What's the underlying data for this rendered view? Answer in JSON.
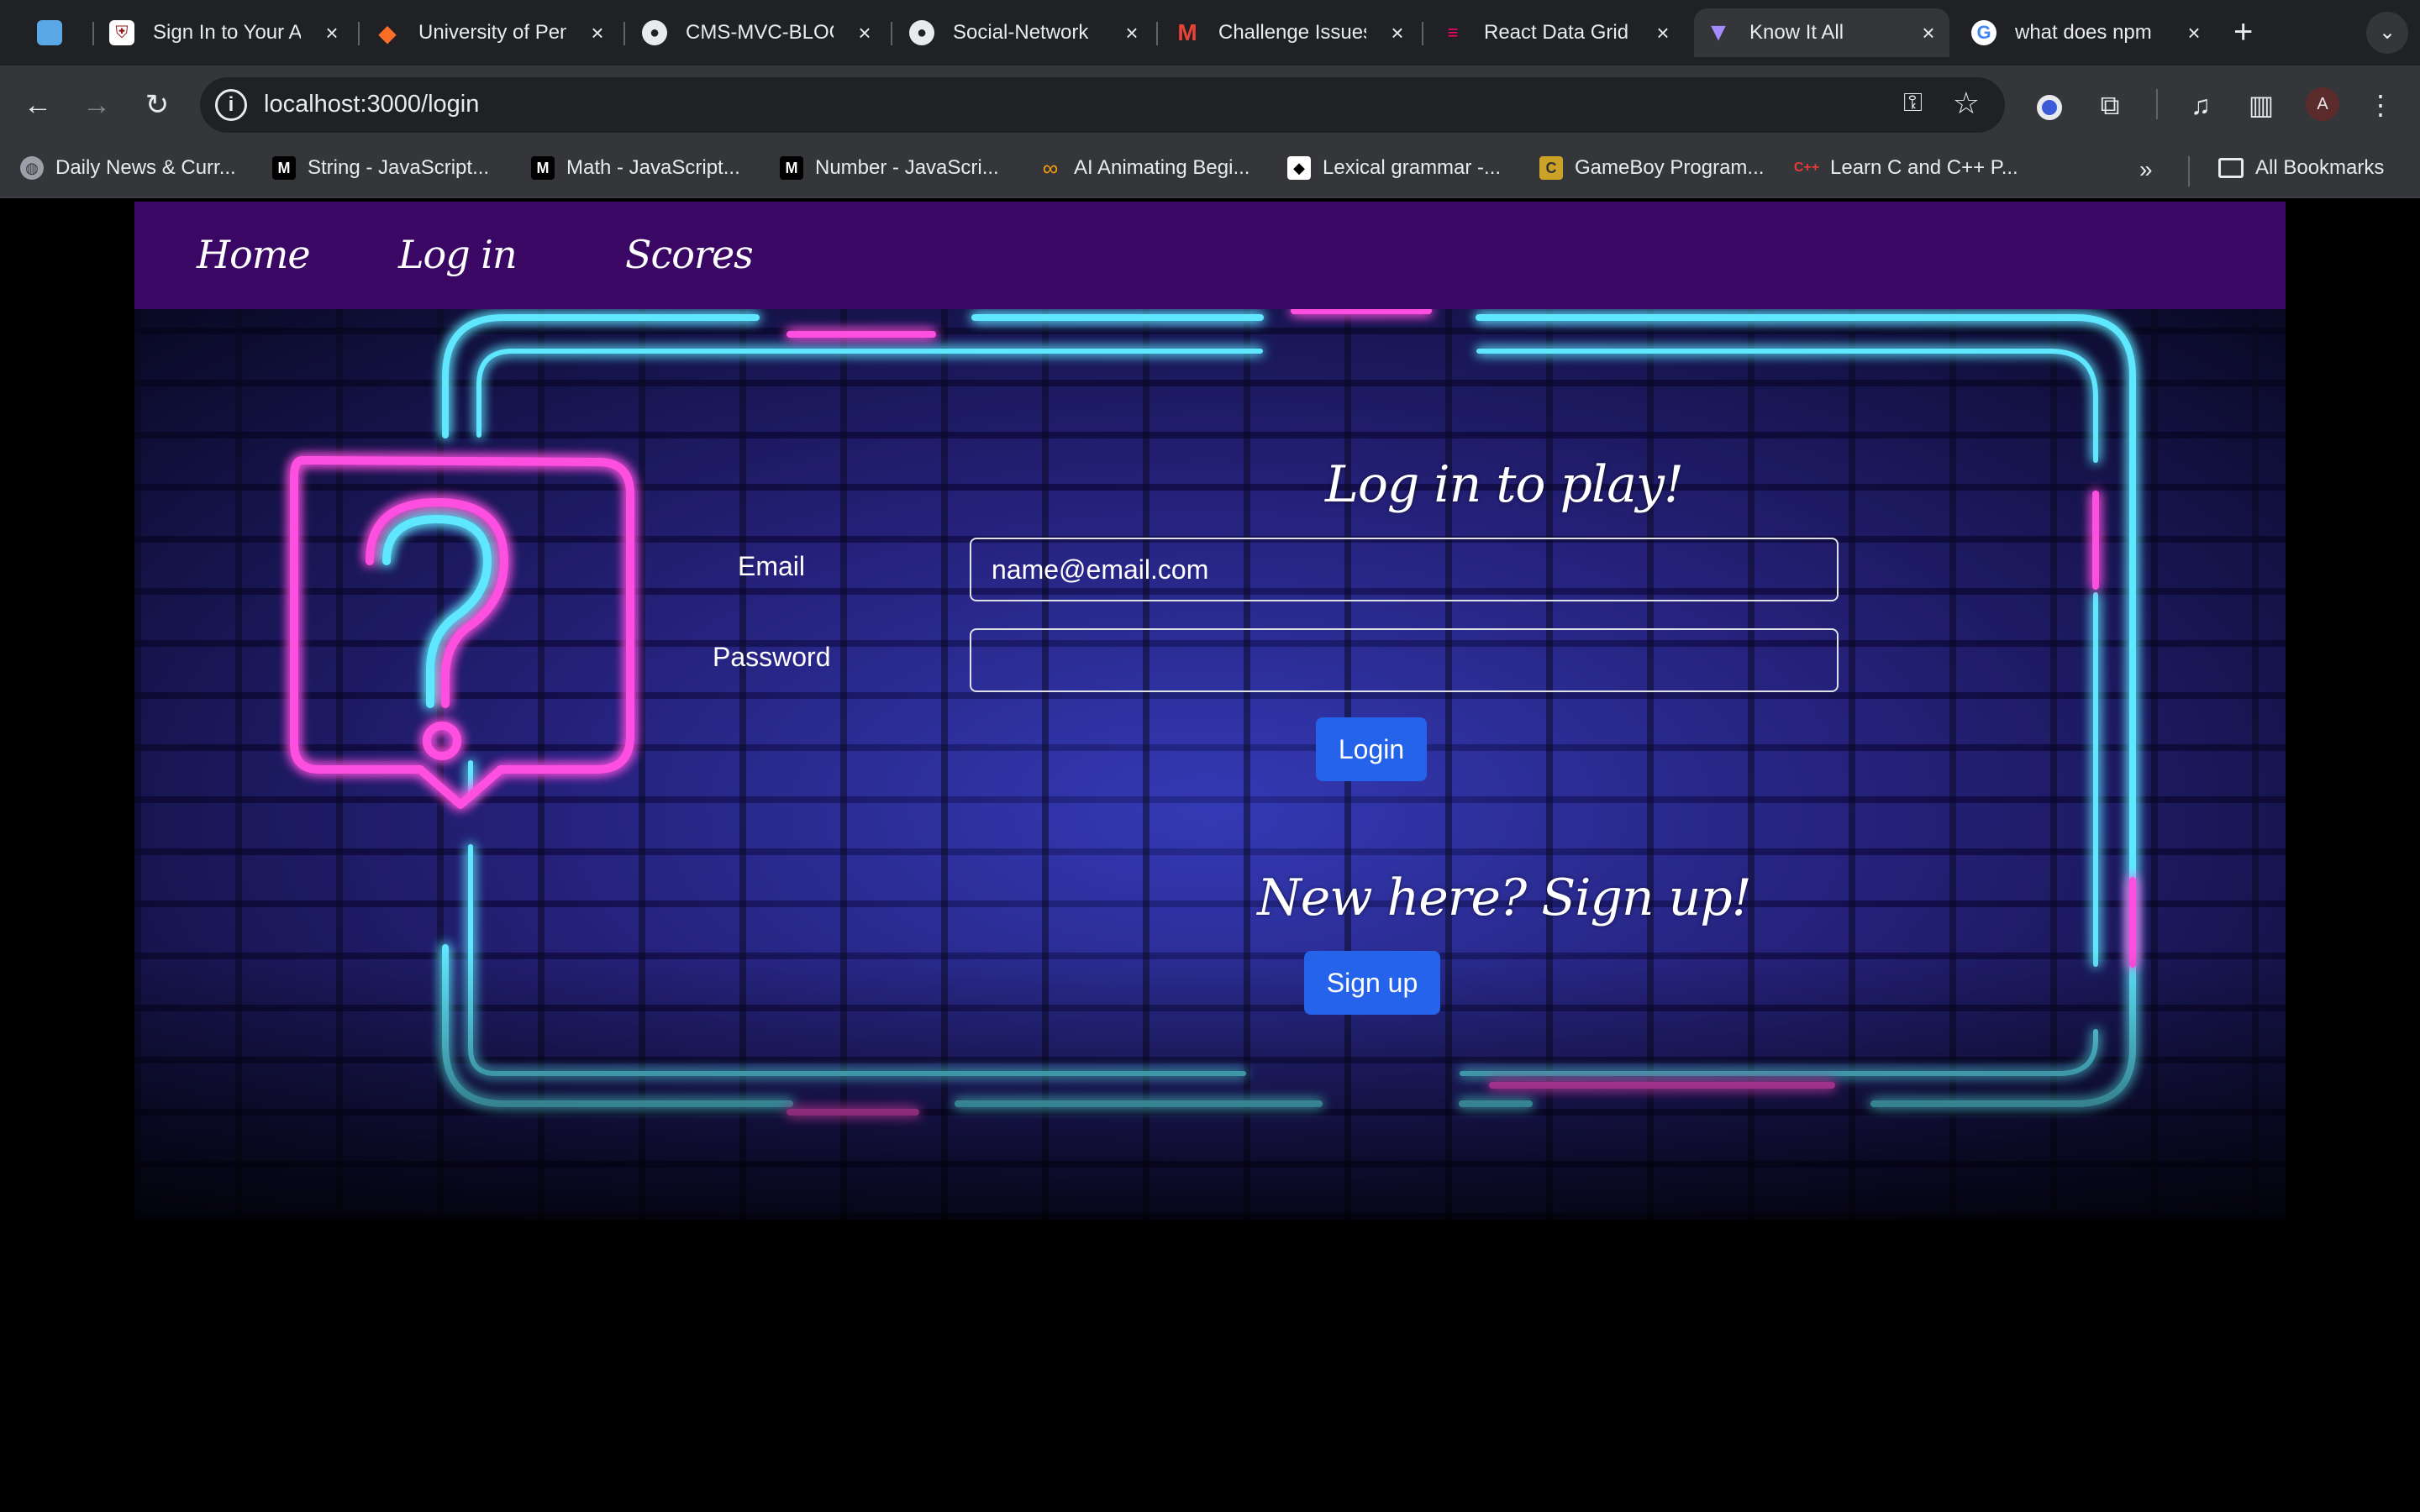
{
  "browser": {
    "tabs": [
      {
        "title": "",
        "icon": "app-icon"
      },
      {
        "title": "Sign In to Your Account",
        "icon": "university-shield-icon"
      },
      {
        "title": "University of Pennsylvania",
        "icon": "gitlab-icon"
      },
      {
        "title": "CMS-MVC-BLOG",
        "icon": "github-icon"
      },
      {
        "title": "Social-Network",
        "icon": "github-icon"
      },
      {
        "title": "Challenge Issues",
        "icon": "gmail-icon"
      },
      {
        "title": "React Data Grid",
        "icon": "data-grid-icon"
      },
      {
        "title": "Know It All",
        "icon": "vite-icon"
      },
      {
        "title": "what does npm",
        "icon": "google-icon"
      }
    ],
    "active_tab": 7,
    "url": "localhost:3000/login",
    "bookmarks": [
      {
        "label": "Daily News & Curr...",
        "icon": "globe-icon"
      },
      {
        "label": "String - JavaScript...",
        "icon": "mdn-icon"
      },
      {
        "label": "Math - JavaScript...",
        "icon": "mdn-icon"
      },
      {
        "label": "Number - JavaScri...",
        "icon": "mdn-icon"
      },
      {
        "label": "AI Animating Begi...",
        "icon": "infinity-icon"
      },
      {
        "label": "Lexical grammar -...",
        "icon": "bookmark-icon"
      },
      {
        "label": "GameBoy Program...",
        "icon": "c-icon"
      },
      {
        "label": "Learn C and C++ P...",
        "icon": "cpp-icon"
      }
    ],
    "all_bookmarks_label": "All Bookmarks",
    "profile_initial": "A"
  },
  "nav": {
    "home": "Home",
    "login": "Log in",
    "scores": "Scores"
  },
  "login": {
    "heading": "Log in to play!",
    "email_label": "Email",
    "email_placeholder": "name@email.com",
    "password_label": "Password",
    "password_placeholder": "",
    "login_button": "Login"
  },
  "signup": {
    "heading": "New here? Sign up!",
    "button": "Sign up"
  },
  "colors": {
    "nav_bg": "#3a0764",
    "button_bg": "#2563eb",
    "neon_cyan": "#5ee7ff",
    "neon_pink": "#ff4fe0"
  }
}
